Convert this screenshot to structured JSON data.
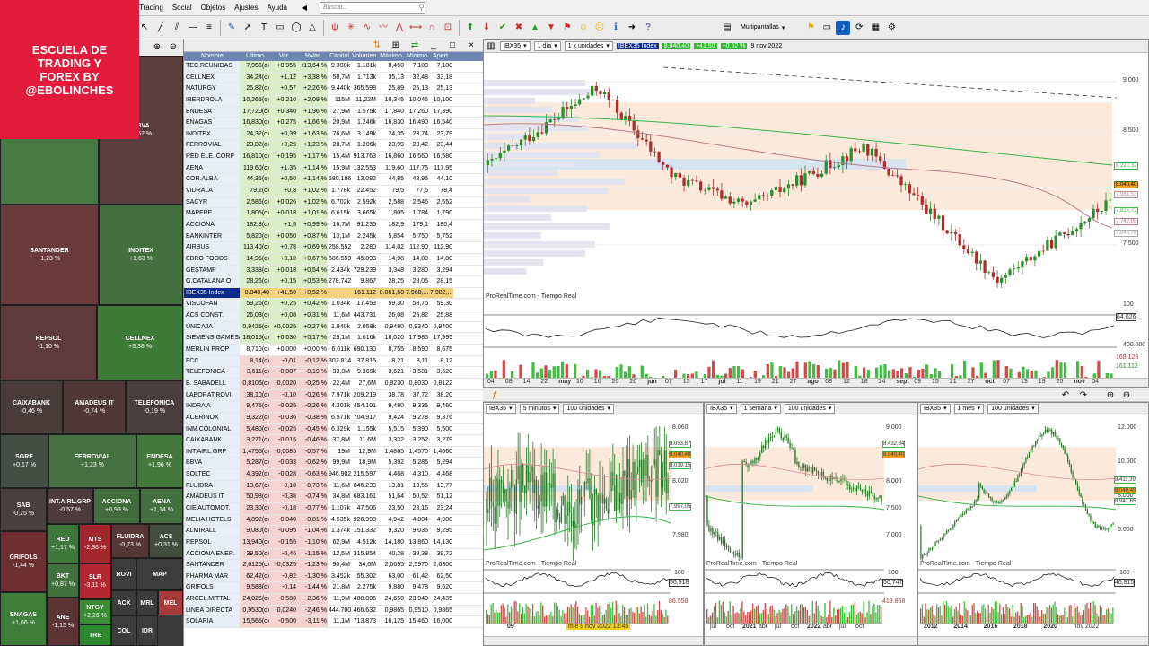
{
  "brand": {
    "line1": "ESCUELA DE",
    "line2": "TRADING Y",
    "line3": "FOREX BY",
    "line4": "@EBOLINCHES"
  },
  "menu": {
    "items": [
      "Trading",
      "Social",
      "Objetos",
      "Ajustes",
      "Ayuda"
    ],
    "search_placeholder": "Buscar..."
  },
  "toolbar": {
    "multiscreen": "Multipantallas"
  },
  "colors": {
    "up": "#2db82d",
    "down": "#c62929",
    "accent": "#0b2c8a",
    "brand": "#e31b3b"
  },
  "heatmap": {
    "tiles": [
      {
        "name": "IBERDROLA",
        "pct": "+2,09 %"
      },
      {
        "name": "BBVA",
        "pct": "-0,62 %"
      },
      {
        "name": "SANTANDER",
        "pct": "-1,23 %"
      },
      {
        "name": "INDITEX",
        "pct": "+1,63 %"
      },
      {
        "name": "REPSOL",
        "pct": "-1,10 %"
      },
      {
        "name": "CELLNEX",
        "pct": "+3,38 %"
      },
      {
        "name": "CAIXABANK",
        "pct": "-0,46 %"
      },
      {
        "name": "AMADEUS IT",
        "pct": "-0,74 %"
      },
      {
        "name": "TELEFONICA",
        "pct": "-0,19 %"
      },
      {
        "name": "SGRE",
        "pct": "+0,17 %"
      },
      {
        "name": "FERROVIAL",
        "pct": "+1,23 %"
      },
      {
        "name": "ENDESA",
        "pct": "+1,96 %"
      },
      {
        "name": "SAB",
        "pct": "-0,25 %"
      },
      {
        "name": "INT.AIRL.GRP",
        "pct": "-0,57 %"
      },
      {
        "name": "ACCIONA",
        "pct": "+0,99 %"
      },
      {
        "name": "AENA",
        "pct": "+1,14 %"
      },
      {
        "name": "GRIFOLS",
        "pct": "-1,44 %"
      },
      {
        "name": "RED",
        "pct": "+1,17 %"
      },
      {
        "name": "MTS",
        "pct": "-2,36 %"
      },
      {
        "name": "FLUIDRA",
        "pct": "-0,73 %"
      },
      {
        "name": "ACS",
        "pct": "+0,31 %"
      },
      {
        "name": "BKT",
        "pct": "+0,87 %"
      },
      {
        "name": "SLR",
        "pct": "-3,11 %"
      },
      {
        "name": "ROVI",
        "pct": ""
      },
      {
        "name": "MAP",
        "pct": ""
      },
      {
        "name": "ENAGAS",
        "pct": "+1,66 %"
      },
      {
        "name": "NTGY",
        "pct": "+2,26 %"
      },
      {
        "name": "ACX",
        "pct": ""
      },
      {
        "name": "MRL",
        "pct": ""
      },
      {
        "name": "MEL",
        "pct": ""
      },
      {
        "name": "ANE",
        "pct": "-1,15 %"
      },
      {
        "name": "TRE",
        "pct": ""
      },
      {
        "name": "COL",
        "pct": ""
      },
      {
        "name": "IDR",
        "pct": ""
      }
    ]
  },
  "watchlist": {
    "columns": [
      "Nombre",
      "Último",
      "Var",
      "%Var",
      "Capital",
      "Volumen",
      "Máximo",
      "Mínimo",
      "Apert."
    ],
    "rows": [
      [
        "TEC.REUNIDAS",
        "7,955(c)",
        "+0,955",
        "+13,64 %",
        "9.398k",
        "1.181k",
        "8,450",
        "7,180",
        "7,180"
      ],
      [
        "CELLNEX",
        "34,24(c)",
        "+1,12",
        "+3,38 %",
        "58,7M",
        "1.713k",
        "35,13",
        "32,48",
        "33,18"
      ],
      [
        "NATURGY",
        "25,82(c)",
        "+0,57",
        "+2,26 %",
        "9.440k",
        "365.598",
        "25,89",
        "25,13",
        "25,13"
      ],
      [
        "IBERDROLA",
        "10,265(c)",
        "+0,210",
        "+2,09 %",
        "115M",
        "11,22M",
        "10,345",
        "10,045",
        "10,100"
      ],
      [
        "ENDESA",
        "17,720(c)",
        "+0,340",
        "+1,96 %",
        "27,9M",
        "1.575k",
        "17,840",
        "17,260",
        "17,390"
      ],
      [
        "ENAGAS",
        "16,830(c)",
        "+0,275",
        "+1,66 %",
        "20,9M",
        "1.246k",
        "16,830",
        "16,490",
        "16,540"
      ],
      [
        "INDITEX",
        "24,32(c)",
        "+0,39",
        "+1,63 %",
        "76,6M",
        "3.149k",
        "24,35",
        "23,74",
        "23,79"
      ],
      [
        "FERROVIAL",
        "23,82(c)",
        "+0,29",
        "+1,23 %",
        "28,7M",
        "1.206k",
        "23,99",
        "23,42",
        "23,44"
      ],
      [
        "RED ELE. CORP",
        "16,810(c)",
        "+0,195",
        "+1,17 %",
        "15,4M",
        "913.763",
        "16,860",
        "16,560",
        "16,580"
      ],
      [
        "AENA",
        "119,60(c)",
        "+1,35",
        "+1,14 %",
        "15,9M",
        "132.553",
        "119,60",
        "117,75",
        "117,95"
      ],
      [
        "COR.ALBA",
        "44,35(c)",
        "+0,50",
        "+1,14 %",
        "580.186",
        "13.082",
        "44,85",
        "43,95",
        "44,10"
      ],
      [
        "VIDRALA",
        "79,2(c)",
        "+0,8",
        "+1,02 %",
        "1.778k",
        "22.452",
        "79,5",
        "77,5",
        "78,4"
      ],
      [
        "SACYR",
        "2,586(c)",
        "+0,026",
        "+1,02 %",
        "6.702k",
        "2.592k",
        "2,588",
        "2,546",
        "2,552"
      ],
      [
        "MAPFRE",
        "1,805(c)",
        "+0,018",
        "+1,01 %",
        "6.615k",
        "3.665k",
        "1,805",
        "1,784",
        "1,790"
      ],
      [
        "ACCIONA",
        "182,8(c)",
        "+1,8",
        "+0,99 %",
        "16,7M",
        "91.235",
        "182,9",
        "179,1",
        "180,4"
      ],
      [
        "BANKINTER",
        "5,820(c)",
        "+0,050",
        "+0,87 %",
        "13,1M",
        "2.245k",
        "5,854",
        "5,750",
        "5,752"
      ],
      [
        "AIRBUS",
        "113,40(c)",
        "+0,78",
        "+0,69 %",
        "258.552",
        "2.280",
        "114,02",
        "112,90",
        "112,90"
      ],
      [
        "EBRO FOODS",
        "14,96(c)",
        "+0,10",
        "+0,67 %",
        "686.559",
        "45.893",
        "14,98",
        "14,80",
        "14,80"
      ],
      [
        "GESTAMP",
        "3,338(c)",
        "+0,018",
        "+0,54 %",
        "2.434k",
        "729.239",
        "3,348",
        "3,280",
        "3,294"
      ],
      [
        "G.CATALANA O",
        "28,25(c)",
        "+0,15",
        "+0,53 %",
        "278.742",
        "9.867",
        "28,25",
        "28,05",
        "28,15"
      ],
      [
        "IBEX35 Index",
        "8.040,40",
        "+41,50",
        "+0,52 %",
        "",
        "161.112",
        "8.061,60",
        "7.968,...",
        "7.982,..."
      ],
      [
        "VISCOFAN",
        "59,25(c)",
        "+0,25",
        "+0,42 %",
        "1.034k",
        "17.453",
        "59,30",
        "58,75",
        "59,30"
      ],
      [
        "ACS CONST.",
        "26,03(c)",
        "+0,08",
        "+0,31 %",
        "11,6M",
        "443.731",
        "26,08",
        "25,82",
        "25,88"
      ],
      [
        "UNICAJA",
        "0,9425(c)",
        "+0,0025",
        "+0,27 %",
        "1.940k",
        "2.058k",
        "0,9480",
        "0,9340",
        "0,9400"
      ],
      [
        "SIEMENS GAMESA",
        "18,015(c)",
        "+0,030",
        "+0,17 %",
        "29,1M",
        "1.616k",
        "18,020",
        "17,985",
        "17,995"
      ],
      [
        "MERLIN PROP",
        "8,710(c)",
        "+0,000",
        "+0,00 %",
        "6.011k",
        "690.130",
        "8,755",
        "8,590",
        "8,675"
      ],
      [
        "FCC",
        "8,14(c)",
        "-0,01",
        "-0,12 %",
        "307.814",
        "37.815",
        "8,21",
        "8,11",
        "8,12"
      ],
      [
        "TELEFONICA",
        "3,611(c)",
        "-0,007",
        "-0,19 %",
        "33,8M",
        "9.369k",
        "3,621",
        "3,581",
        "3,620"
      ],
      [
        "B. SABADELL",
        "0,8106(c)",
        "-0,0020",
        "-0,25 %",
        "22,4M",
        "27,6M",
        "0,8230",
        "0,8030",
        "0,8122"
      ],
      [
        "LABORAT.ROVI",
        "38,10(c)",
        "-0,10",
        "-0,26 %",
        "7.971k",
        "209.219",
        "38,78",
        "37,72",
        "38,20"
      ],
      [
        "INDRA A",
        "9,475(c)",
        "-0,025",
        "-0,26 %",
        "4.301k",
        "454.101",
        "9,480",
        "9,335",
        "9,460"
      ],
      [
        "ACERINOX",
        "9,322(c)",
        "-0,036",
        "-0,38 %",
        "6.571k",
        "704.917",
        "9,424",
        "9,278",
        "9,376"
      ],
      [
        "INM.COLONIAL",
        "5,480(c)",
        "-0,025",
        "-0,45 %",
        "6.329k",
        "1.155k",
        "5,515",
        "5,390",
        "5,500"
      ],
      [
        "CAIXABANK",
        "3,271(c)",
        "-0,015",
        "-0,46 %",
        "37,8M",
        "11,6M",
        "3,332",
        "3,252",
        "3,279"
      ],
      [
        "INT.AIRL.GRP",
        "1,4755(c)",
        "-0,0085",
        "-0,57 %",
        "19M",
        "12,9M",
        "1,4865",
        "1,4570",
        "1,4660"
      ],
      [
        "BBVA",
        "5,287(c)",
        "-0,033",
        "-0,62 %",
        "99,9M",
        "18,9M",
        "5,392",
        "5,286",
        "5,294"
      ],
      [
        "SOLTEC",
        "4,392(c)",
        "-0,028",
        "-0,63 %",
        "946.902",
        "215.597",
        "4,468",
        "4,310",
        "4,468"
      ],
      [
        "FLUIDRA",
        "13,67(c)",
        "-0,10",
        "-0,73 %",
        "11,6M",
        "846.230",
        "13,81",
        "13,55",
        "13,77"
      ],
      [
        "AMADEUS IT",
        "50,98(c)",
        "-0,38",
        "-0,74 %",
        "34,8M",
        "683.161",
        "51,64",
        "50,52",
        "51,12"
      ],
      [
        "CIE AUTOMOT.",
        "23,30(c)",
        "-0,18",
        "-0,77 %",
        "1.107k",
        "47.506",
        "23,50",
        "23,16",
        "23,24"
      ],
      [
        "MELIA HOTELS",
        "4,892(c)",
        "-0,040",
        "-0,81 %",
        "4.535k",
        "926.998",
        "4,942",
        "4,804",
        "4,900"
      ],
      [
        "ALMIRALL",
        "9,080(c)",
        "-0,095",
        "-1,04 %",
        "1.374k",
        "151.332",
        "9,320",
        "9,035",
        "9,295"
      ],
      [
        "REPSOL",
        "13,940(c)",
        "-0,155",
        "-1,10 %",
        "62,9M",
        "4.512k",
        "14,180",
        "13,860",
        "14,130"
      ],
      [
        "ACCIONA ENER.",
        "39,50(c)",
        "-0,46",
        "-1,15 %",
        "12,5M",
        "315.854",
        "40,28",
        "39,38",
        "39,72"
      ],
      [
        "SANTANDER",
        "2,6125(c)",
        "-0,0325",
        "-1,23 %",
        "90,4M",
        "34,6M",
        "2,6695",
        "2,5970",
        "2,6300"
      ],
      [
        "PHARMA MAR",
        "62,42(c)",
        "-0,82",
        "-1,30 %",
        "3.452k",
        "55.302",
        "63,00",
        "61,42",
        "62,50"
      ],
      [
        "GRIFOLS",
        "9,588(c)",
        "-0,14",
        "-1,44 %",
        "21,8M",
        "2.275k",
        "9,880",
        "9,478",
        "9,620"
      ],
      [
        "ARCEL.MITTAL",
        "24,025(c)",
        "-0,580",
        "-2,36 %",
        "11,9M",
        "488.806",
        "24,650",
        "23,940",
        "24,435"
      ],
      [
        "LINEA DIRECTA",
        "0,9530(c)",
        "-0,0240",
        "-2,46 %",
        "444.700",
        "466.632",
        "0,9865",
        "0,9510",
        "0,9865"
      ],
      [
        "SOLARIA",
        "15,565(c)",
        "-0,500",
        "-3,11 %",
        "11,1M",
        "713.873",
        "16,125",
        "15,460",
        "16,000"
      ]
    ]
  },
  "main_chart": {
    "symbol": "IBX35",
    "timeframe": "1 día",
    "units": "1 k unidades",
    "index_label": "IBEX35 Index",
    "last": "8.040,40",
    "change": "+41,50",
    "pct": "+0,52 %",
    "date": "9 nov 2022",
    "watermark": "ProRealTime.com - Tiempo Real",
    "y_ticks": [
      "9.000",
      "8.500",
      "8.000",
      "7.500"
    ],
    "price_tags": [
      "8.210,32",
      "8.040,40",
      "7.961,53",
      "7.825,72",
      "7.742,08",
      "7.645,78"
    ],
    "osc_value": "64,026",
    "osc_ticks": [
      "100",
      "0"
    ],
    "vol_ticks": [
      "400.000",
      "200.000"
    ],
    "vol_tags": [
      "168.128",
      "161.112"
    ],
    "x_labels": [
      "04",
      "08",
      "14",
      "22",
      "may",
      "10",
      "16",
      "20",
      "26",
      "jun",
      "07",
      "13",
      "17",
      "jul",
      "11",
      "15",
      "21",
      "27",
      "ago",
      "08",
      "12",
      "18",
      "24",
      "sept",
      "09",
      "15",
      "21",
      "27",
      "oct",
      "07",
      "13",
      "19",
      "25",
      "nov",
      "04"
    ]
  },
  "mini_charts": [
    {
      "symbol": "IBX35",
      "timeframe": "5 minutos",
      "units": "100 unidades",
      "y_ticks": [
        "8.060",
        "8.040",
        "8.020",
        "8.000",
        "7.980"
      ],
      "price_tags": [
        "8.053,87",
        "8.040,40",
        "8.039,15",
        "7.997,05"
      ],
      "watermark": "ProRealTime.com - Tiempo Real",
      "osc_value": "56,918",
      "osc_ticks": [
        "100",
        "0"
      ],
      "vol_tag": "86.558",
      "x_labels": [
        "09",
        "mié 9 nov 2022 13:45"
      ]
    },
    {
      "symbol": "IBX35",
      "timeframe": "1 semana",
      "units": "100 unidades",
      "y_ticks": [
        "9.000",
        "8.500",
        "8.000",
        "7.500",
        "7.000"
      ],
      "price_tags": [
        "8.432,84",
        "8.040,40"
      ],
      "watermark": "ProRealTime.com - Tiempo Real",
      "osc_value": "50,747",
      "osc_ticks": [
        "100",
        "0"
      ],
      "vol_tag": "419.868",
      "x_labels": [
        "jul",
        "oct",
        "2021",
        "abr",
        "jul",
        "oct",
        "2022",
        "abr",
        "jul",
        "oct"
      ]
    },
    {
      "symbol": "IBX35",
      "timeframe": "1 mes",
      "units": "100 unidades",
      "y_ticks": [
        "12.000",
        "10.000",
        "8.000",
        "6.000"
      ],
      "price_tags": [
        "8.411,39",
        "8.040,40",
        "8.941,65"
      ],
      "watermark": "ProRealTime.com - Tiempo Real",
      "osc_value": "46,815",
      "osc_ticks": [
        "100",
        "0"
      ],
      "vol_tag": "",
      "x_labels": [
        "2012",
        "2014",
        "2016",
        "2018",
        "2020",
        "nov 2022"
      ]
    }
  ]
}
